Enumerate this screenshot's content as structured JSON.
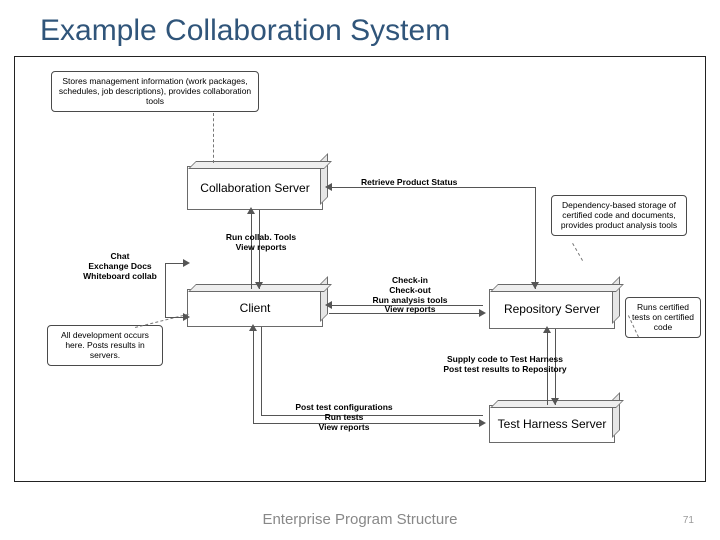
{
  "title": "Example Collaboration System",
  "footer": "Enterprise Program Structure",
  "page": "71",
  "nodes": {
    "collab": "Collaboration Server",
    "client": "Client",
    "repo": "Repository Server",
    "harness": "Test Harness Server"
  },
  "edges": {
    "retrieve_status": "Retrieve Product Status",
    "run_collab": "Run collab. Tools\nView reports",
    "chat": "Chat\nExchange Docs\nWhiteboard collab",
    "checkin": "Check-in\nCheck-out\nRun analysis tools\nView reports",
    "supply": "Supply code to Test Harness\nPost test results to Repository",
    "post_test": "Post test configurations\nRun tests\nView reports"
  },
  "notes": {
    "top": "Stores management information (work packages, schedules, job descriptions), provides collaboration tools",
    "repo": "Dependency-based storage of certified code and documents, provides product analysis tools",
    "harness": "Runs certified tests on certified code",
    "client": "All development occurs here. Posts results in servers."
  }
}
